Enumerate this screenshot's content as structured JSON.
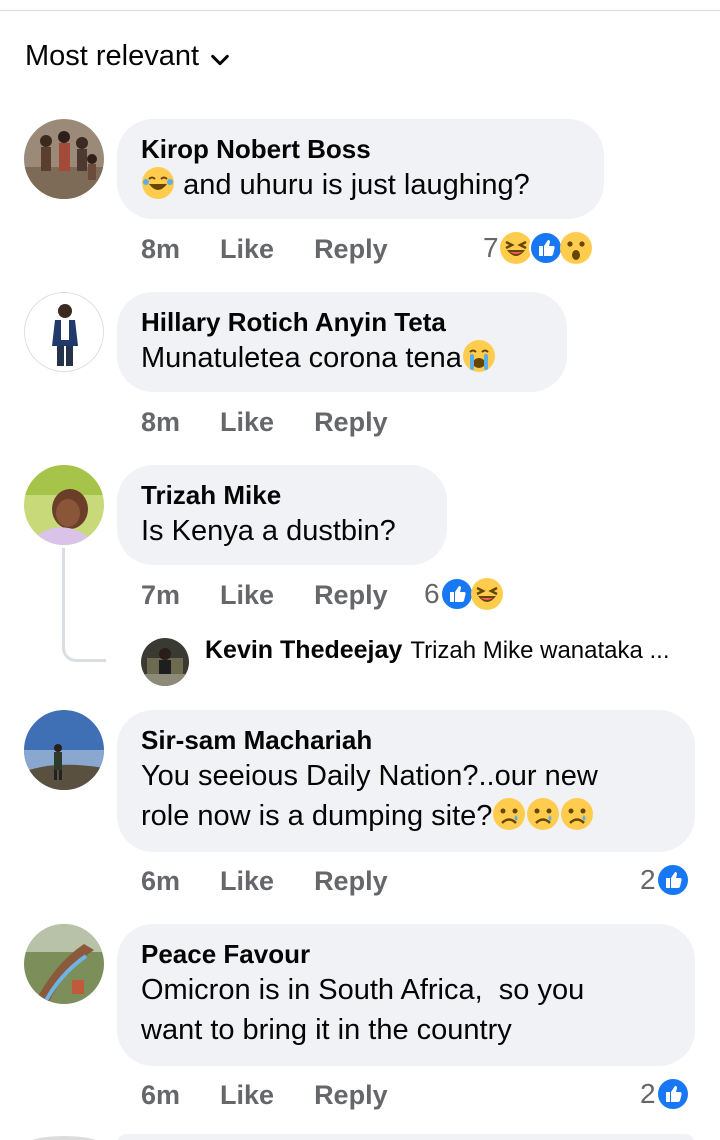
{
  "sort": {
    "label": "Most relevant"
  },
  "comments": [
    {
      "author": "Kirop Nobert Boss",
      "text": "and uhuru is just laughing?",
      "time": "8m",
      "like": "Like",
      "reply": "Reply",
      "reaction_count": "7",
      "reactions": [
        "laughing-emoji-icon",
        "like-reaction-icon",
        "wow-reaction-icon"
      ]
    },
    {
      "author": "Hillary Rotich Anyin Teta",
      "text": "Munatuletea corona tena",
      "time": "8m",
      "like": "Like",
      "reply": "Reply"
    },
    {
      "author": "Trizah Mike",
      "text": "Is Kenya a dustbin?",
      "time": "7m",
      "like": "Like",
      "reply": "Reply",
      "reaction_count": "6",
      "reactions": [
        "like-reaction-icon",
        "haha-reaction-icon"
      ],
      "reply_preview": {
        "author": "Kevin Thedeejay",
        "text": "Trizah Mike wanataka ..."
      }
    },
    {
      "author": "Sir-sam Machariah",
      "text_line1": "You seeious Daily Nation?..our new",
      "text_line2": "role now is a dumping site?",
      "time": "6m",
      "like": "Like",
      "reply": "Reply",
      "reaction_count": "2",
      "reactions": [
        "like-reaction-icon"
      ]
    },
    {
      "author": "Peace Favour",
      "text_line1": "Omicron is in South Africa,  so you",
      "text_line2": "want to bring it in the country",
      "time": "6m",
      "like": "Like",
      "reply": "Reply",
      "reaction_count": "2",
      "reactions": [
        "like-reaction-icon"
      ]
    }
  ],
  "colors": {
    "bubble": "#f0f2f5",
    "meta": "#65676b",
    "like_blue": "#1877f2",
    "emoji_yellow": "#ffcc4d"
  }
}
